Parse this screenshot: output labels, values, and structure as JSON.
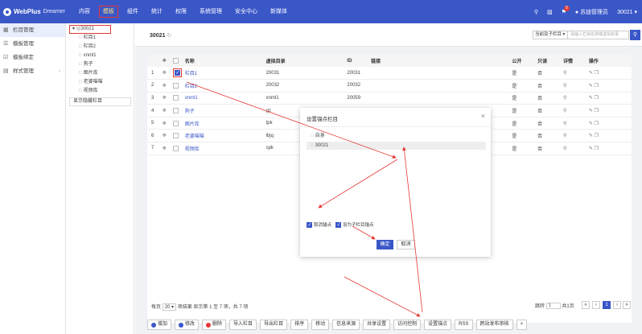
{
  "topbar": {
    "logo": "WebPlus",
    "logo_sub": "Dreamer",
    "nav": [
      "内容",
      "模板",
      "组件",
      "统计",
      "权限",
      "系统管理",
      "安全中心",
      "新媒体"
    ],
    "user": "苏迪管理员",
    "site": "30021",
    "notification_count": "0"
  },
  "sidebar": {
    "items": [
      {
        "icon": "grid-icon",
        "label": "栏目管理",
        "active": true
      },
      {
        "icon": "list-icon",
        "label": "模板管理"
      },
      {
        "icon": "check-icon",
        "label": "模板绑定"
      },
      {
        "icon": "folder-icon",
        "label": "样式管理",
        "has_children": true
      }
    ]
  },
  "tree": {
    "root": "30021",
    "children": [
      "栏目1",
      "栏目2",
      "xnml1",
      "狗子",
      "图片库",
      "老婆喵喵",
      "视频库"
    ],
    "hidden_toggle": "显示隐藏栏目"
  },
  "main": {
    "crumb": "30021",
    "scope": "当前及子栏目",
    "search_placeholder": "请输入栏目名称或虚拟目录",
    "columns": [
      "",
      "",
      "",
      "名称",
      "虚拟目录",
      "ID",
      "链接",
      "公开",
      "只读",
      "详情",
      "操作"
    ],
    "rows": [
      {
        "num": "1",
        "name": "栏目1",
        "vdir": "20031",
        "id": "20031",
        "pub": "是",
        "ro": "否",
        "checked": true
      },
      {
        "num": "2",
        "name": "栏目2",
        "vdir": "20032",
        "id": "20032",
        "pub": "是",
        "ro": "否"
      },
      {
        "num": "3",
        "name": "xnml1",
        "vdir": "xnml1",
        "id": "20059",
        "pub": "是",
        "ro": "否"
      },
      {
        "num": "4",
        "name": "狗子",
        "vdir": "gz",
        "id": "",
        "pub": "是",
        "ro": "否"
      },
      {
        "num": "5",
        "name": "图片库",
        "vdir": "tpk",
        "id": "",
        "pub": "是",
        "ro": "否"
      },
      {
        "num": "6",
        "name": "老婆喵喵",
        "vdir": "lbjq",
        "id": "",
        "pub": "是",
        "ro": "否"
      },
      {
        "num": "7",
        "name": "视频库",
        "vdir": "spk",
        "id": "",
        "pub": "是",
        "ro": "否"
      }
    ],
    "pager": {
      "per_page_label": "每页",
      "per_page": "20",
      "summary": "项结果 显示第 1 至 7 项，共 7 项",
      "jump_label": "跳转",
      "jump_value": "1",
      "total_pages": "共1页",
      "current_page": "1"
    },
    "actions": [
      {
        "label": "增加",
        "color": "#3a57c8"
      },
      {
        "label": "修改",
        "color": "#3a57c8"
      },
      {
        "label": "删除",
        "color": "#e53935"
      },
      {
        "label": "导入栏目"
      },
      {
        "label": "导出栏目"
      },
      {
        "label": "排序"
      },
      {
        "label": "移动"
      },
      {
        "label": "信息来源"
      },
      {
        "label": "共享设置"
      },
      {
        "label": "访问控制"
      },
      {
        "label": "设置锚点"
      },
      {
        "label": "RSS"
      },
      {
        "label": "跨站发布审核"
      },
      {
        "label": ">"
      }
    ]
  },
  "modal": {
    "title": "设置锚点栏目",
    "items": [
      "自身",
      "30021"
    ],
    "opt_cancel": "取消锚点",
    "opt_apply_children": "设为子栏目锚点",
    "ok": "确定",
    "cancel": "取消"
  },
  "colors": {
    "primary": "#3a57c8",
    "annotation": "#e53935"
  }
}
